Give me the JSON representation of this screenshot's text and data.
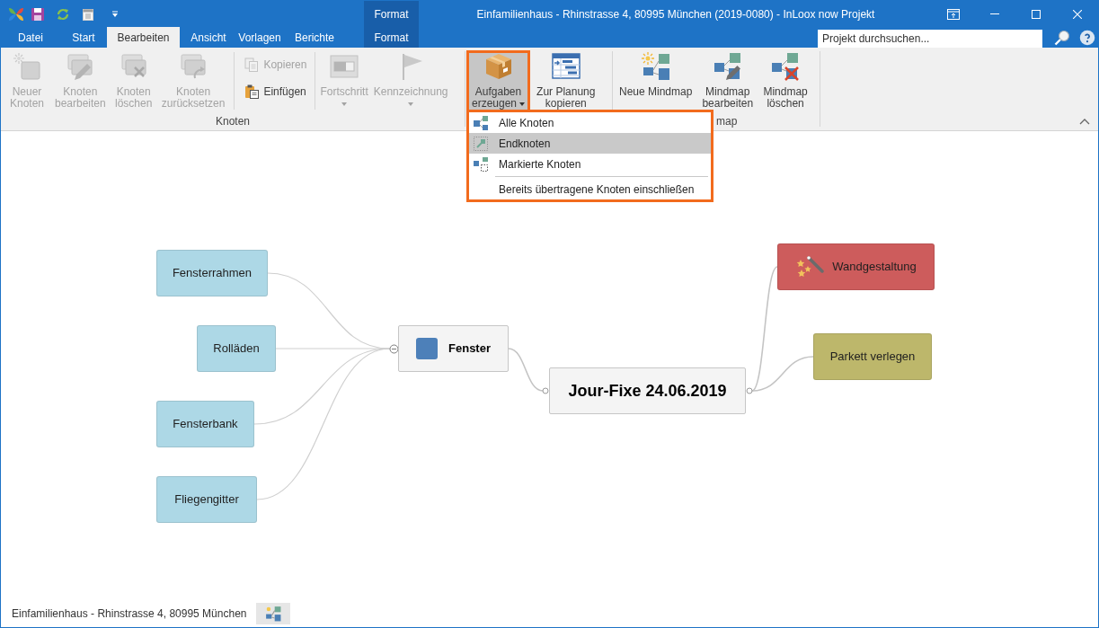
{
  "window": {
    "title": "Einfamilienhaus - Rhinstrasse 4, 80995 München (2019-0080) - InLoox now Projekt",
    "context_tab_header": "Format"
  },
  "tabs": [
    {
      "label": "Datei",
      "kind": "normal",
      "selected": false
    },
    {
      "label": "Start",
      "kind": "normal",
      "selected": false
    },
    {
      "label": "Bearbeiten",
      "kind": "normal",
      "selected": true
    },
    {
      "label": "Ansicht",
      "kind": "normal",
      "selected": false
    },
    {
      "label": "Vorlagen",
      "kind": "normal",
      "selected": false
    },
    {
      "label": "Berichte",
      "kind": "normal",
      "selected": false
    },
    {
      "label": "Format",
      "kind": "contextual",
      "selected": false
    }
  ],
  "search": {
    "placeholder": "Projekt durchsuchen..."
  },
  "ribbon": {
    "groups": [
      {
        "label": "Knoten",
        "buttons": [
          {
            "label": "Neuer\nKnoten",
            "kind": "large",
            "disabled": true,
            "pressed": false
          },
          {
            "label": "Knoten\nbearbeiten",
            "kind": "large",
            "disabled": true,
            "pressed": false
          },
          {
            "label": "Knoten\nlöschen",
            "kind": "large",
            "disabled": true,
            "pressed": false
          },
          {
            "label": "Knoten\nzurücksetzen",
            "kind": "large",
            "disabled": true,
            "pressed": false
          },
          {
            "label": "Kopieren",
            "kind": "small",
            "disabled": true,
            "pressed": false
          },
          {
            "label": "Einfügen",
            "kind": "small",
            "disabled": false,
            "pressed": false
          },
          {
            "label": "Fortschritt",
            "kind": "menu",
            "disabled": true,
            "pressed": false
          },
          {
            "label": "Kennzeichnung",
            "kind": "menu",
            "disabled": true,
            "pressed": false
          }
        ]
      },
      {
        "buttons": [
          {
            "label": "Aufgaben\nerzeugen",
            "kind": "menu",
            "disabled": false,
            "pressed": true,
            "menu": {
              "items": [
                {
                  "label": "Alle Knoten",
                  "kind": "command",
                  "highlighted": false
                },
                {
                  "label": "Endknoten",
                  "kind": "command",
                  "highlighted": true
                },
                {
                  "label": "Markierte Knoten",
                  "kind": "command",
                  "highlighted": false
                },
                {
                  "label": "Bereits übertragene Knoten einschließen",
                  "kind": "option",
                  "highlighted": false
                }
              ]
            }
          },
          {
            "label": "Zur Planung\nkopieren",
            "kind": "large",
            "disabled": false,
            "pressed": false
          }
        ]
      },
      {
        "label": "map",
        "buttons": [
          {
            "label": "Neue Mindmap",
            "kind": "large",
            "disabled": false,
            "pressed": false
          },
          {
            "label": "Mindmap\nbearbeiten",
            "kind": "large",
            "disabled": false,
            "pressed": false
          },
          {
            "label": "Mindmap\nlöschen",
            "kind": "large",
            "disabled": false,
            "pressed": false
          }
        ]
      }
    ]
  },
  "mindmap": {
    "root": {
      "label": "Jour-Fixe 24.06.2019",
      "kind": "root",
      "color": "#f4f4f4",
      "children": [
        {
          "label": "Fenster",
          "kind": "topic",
          "color": "#f4f4f4",
          "children": [
            {
              "label": "Fensterrahmen",
              "kind": "subtopic",
              "color": "#add8e6"
            },
            {
              "label": "Rolläden",
              "kind": "subtopic",
              "color": "#add8e6"
            },
            {
              "label": "Fensterbank",
              "kind": "subtopic",
              "color": "#add8e6"
            },
            {
              "label": "Fliegengitter",
              "kind": "subtopic",
              "color": "#add8e6"
            }
          ]
        },
        {
          "label": "Wandgestaltung",
          "kind": "subtopic",
          "color": "#cd5c5c"
        },
        {
          "label": "Parkett verlegen",
          "kind": "subtopic",
          "color": "#bdb76b"
        }
      ]
    }
  },
  "status_bar": {
    "text": "Einfamilienhaus - Rhinstrasse 4, 80995 München"
  }
}
